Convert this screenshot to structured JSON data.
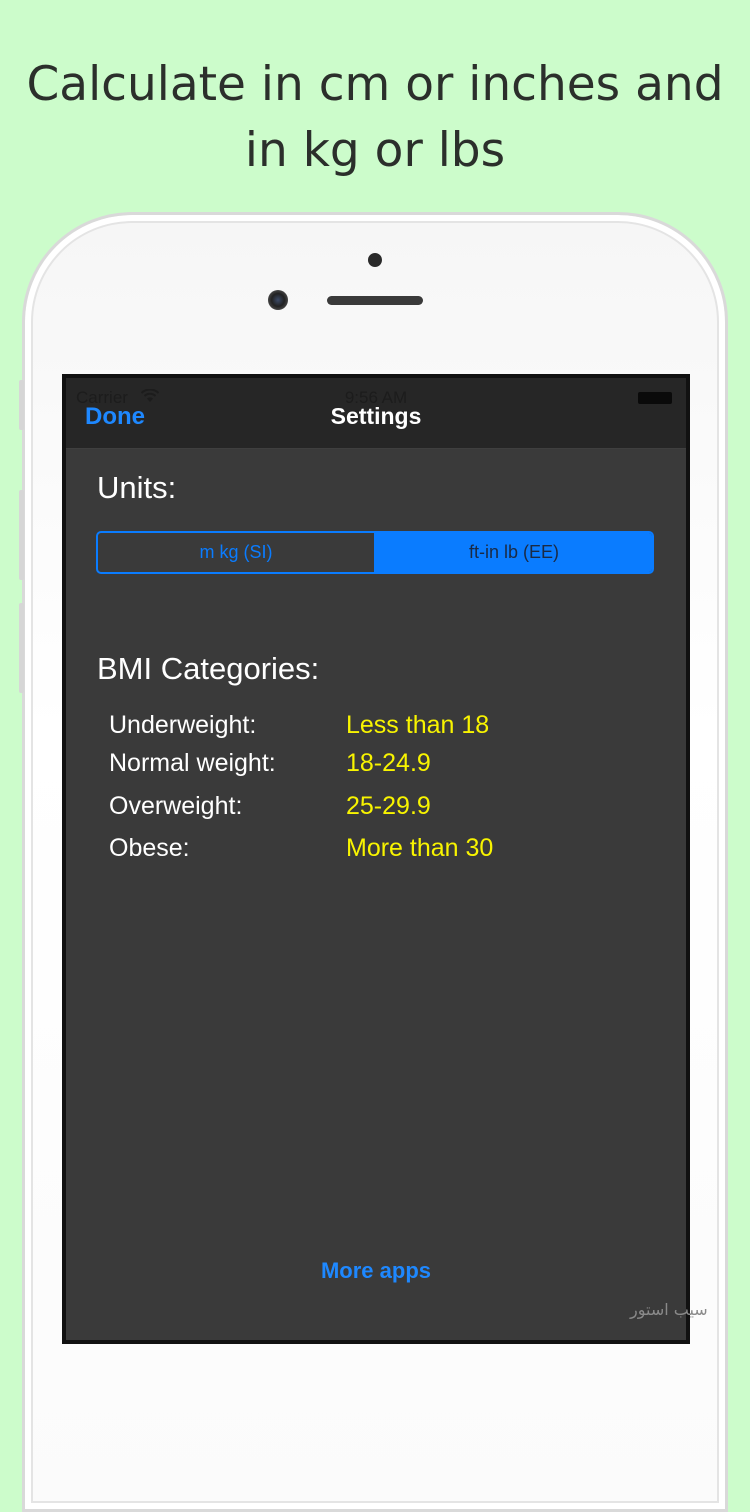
{
  "headline": {
    "line1": "Calculate in cm or inches and",
    "line2": "in kg or lbs"
  },
  "status_bar": {
    "carrier": "Carrier",
    "time": "9:56 AM"
  },
  "nav": {
    "done_label": "Done",
    "title": "Settings"
  },
  "units": {
    "label": "Units:",
    "options": [
      "m kg (SI)",
      "ft-in lb (EE)"
    ],
    "selected": "ft-in lb (EE)"
  },
  "bmi": {
    "label": "BMI Categories:",
    "rows": [
      {
        "name": "Underweight:",
        "range": "Less than 18"
      },
      {
        "name": "Normal weight:",
        "range": "18-24.9"
      },
      {
        "name": "Overweight:",
        "range": "25-29.9"
      },
      {
        "name": "Obese:",
        "range": "More than 30"
      }
    ]
  },
  "footer": {
    "more_apps": "More apps"
  },
  "watermark": "سیب استور",
  "colors": {
    "background": "#ccfccb",
    "accent": "#0a7cff",
    "range_text": "#f8f400",
    "content_bg": "#3a3a3a"
  }
}
